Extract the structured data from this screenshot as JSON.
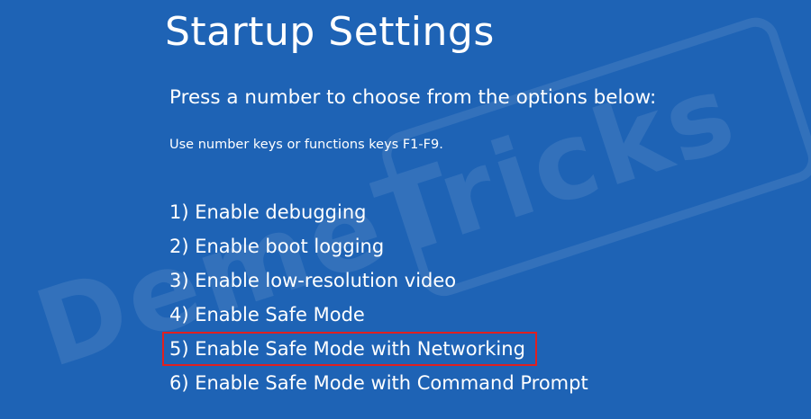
{
  "title": "Startup Settings",
  "subtitle": "Press a number to choose from the options below:",
  "hint": "Use number keys or functions keys F1-F9.",
  "watermark": "DemeTricks",
  "options": [
    "1) Enable debugging",
    "2) Enable boot logging",
    "3) Enable low-resolution video",
    "4) Enable Safe Mode",
    "5) Enable Safe Mode with Networking",
    "6) Enable Safe Mode with Command Prompt"
  ],
  "highlighted_option_index": 4,
  "colors": {
    "background": "#1e63b5",
    "text": "#ffffff",
    "highlight": "#e02020"
  }
}
